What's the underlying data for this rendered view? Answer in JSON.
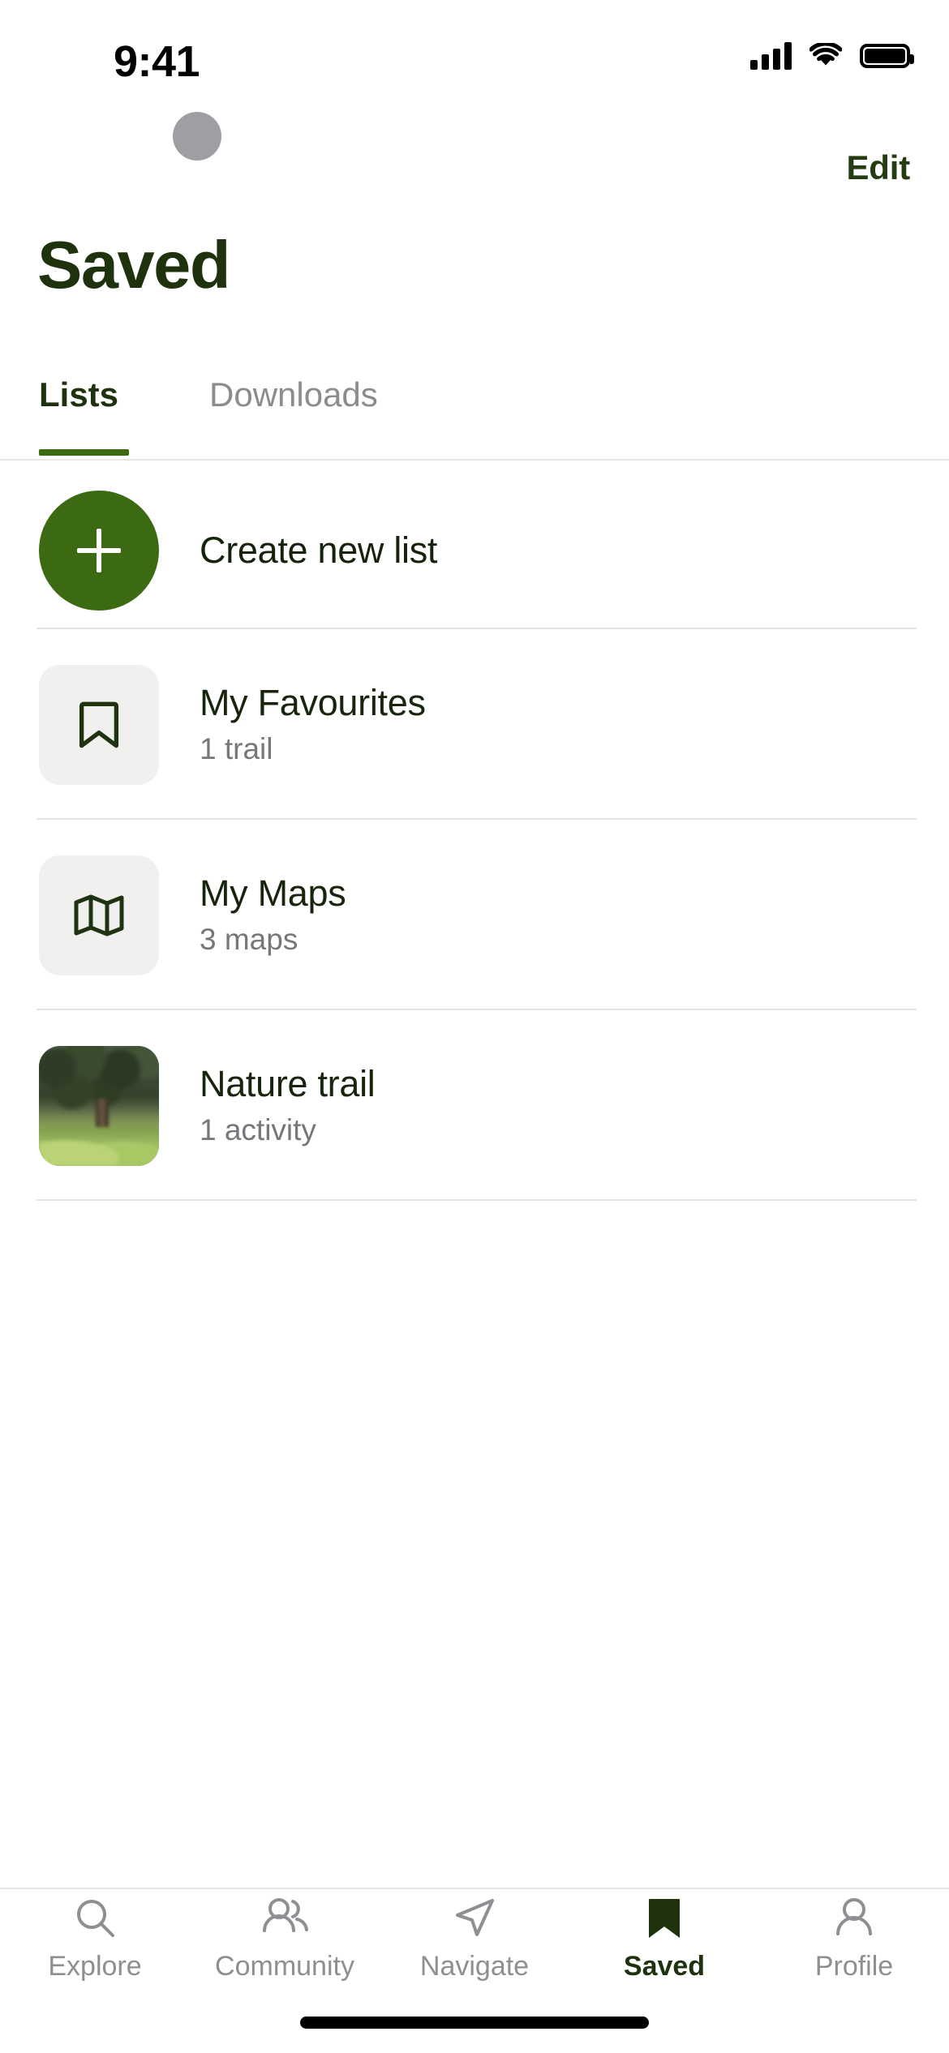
{
  "status_bar": {
    "time": "9:41",
    "signal_icon": "cellular-signal-icon",
    "wifi_icon": "wifi-icon",
    "battery_icon": "battery-full-icon"
  },
  "header": {
    "avatar_placeholder": "avatar-placeholder",
    "edit_label": "Edit",
    "title": "Saved"
  },
  "tabs": {
    "items": [
      {
        "label": "Lists",
        "active": true
      },
      {
        "label": "Downloads",
        "active": false
      }
    ]
  },
  "list": {
    "create": {
      "label": "Create new list",
      "icon": "plus-icon"
    },
    "items": [
      {
        "title": "My Favourites",
        "subtitle": "1 trail",
        "icon": "bookmark-icon"
      },
      {
        "title": "My Maps",
        "subtitle": "3 maps",
        "icon": "map-icon"
      },
      {
        "title": "Nature trail",
        "subtitle": "1 activity",
        "icon": "photo-thumbnail"
      }
    ]
  },
  "tabbar": {
    "items": [
      {
        "label": "Explore",
        "icon": "search-icon",
        "active": false
      },
      {
        "label": "Community",
        "icon": "people-icon",
        "active": false
      },
      {
        "label": "Navigate",
        "icon": "navigate-icon",
        "active": false
      },
      {
        "label": "Saved",
        "icon": "bookmark-filled-icon",
        "active": true
      },
      {
        "label": "Profile",
        "icon": "person-icon",
        "active": false
      }
    ]
  },
  "colors": {
    "brand_green": "#3c6a12",
    "dark_green": "#1e330d",
    "muted_gray": "#8e8e93",
    "tile_gray": "#f0f0ef",
    "separator": "#e3e3e3"
  }
}
